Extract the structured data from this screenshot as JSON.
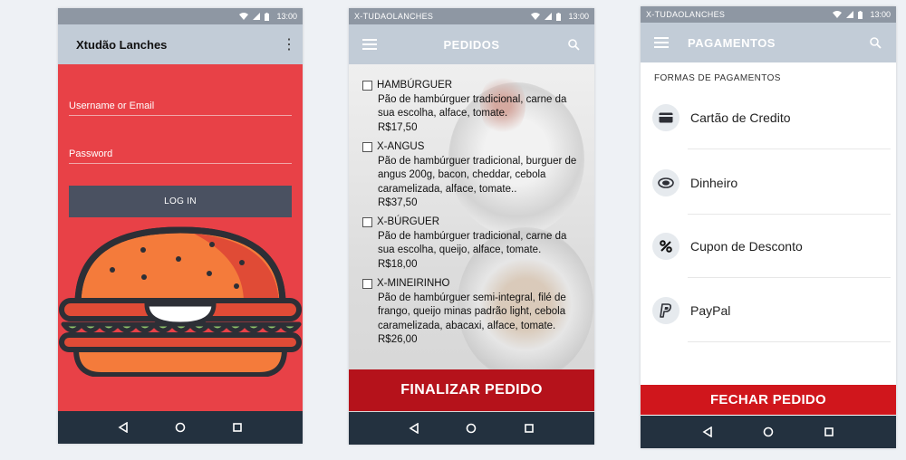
{
  "status": {
    "time": "13:00"
  },
  "screen1": {
    "app_title": "Xtudão Lanches",
    "username_placeholder": "Username or Email",
    "password_placeholder": "Password",
    "login_label": "LOG IN"
  },
  "screen2": {
    "carrier": "X-TUDAOLANCHES",
    "title": "PEDIDOS",
    "items": [
      {
        "name": "HAMBÚRGUER",
        "desc": "Pão de hambúrguer tradicional, carne da sua escolha, alface, tomate.",
        "price": "R$17,50"
      },
      {
        "name": "X-ANGUS",
        "desc": "Pão de hambúrguer tradicional, burguer de angus 200g, bacon, cheddar, cebola caramelizada, alface, tomate..",
        "price": "R$37,50"
      },
      {
        "name": "X-BÚRGUER",
        "desc": "Pão de hambúrguer tradicional, carne da sua escolha, queijo, alface, tomate.",
        "price": "R$18,00"
      },
      {
        "name": "X-MINEIRINHO",
        "desc": "Pão de hambúrguer semi-integral, filé de frango, queijo minas padrão light, cebola caramelizada, abacaxi, alface, tomate.",
        "price": "R$26,00"
      }
    ],
    "finalize_label": "FINALIZAR PEDIDO"
  },
  "screen3": {
    "carrier": "X-TUDAOLANCHES",
    "title": "PAGAMENTOS",
    "section_label": "FORMAS DE PAGAMENTOS",
    "methods": [
      {
        "label": "Cartão de Credito",
        "icon": "credit-card-icon"
      },
      {
        "label": "Dinheiro",
        "icon": "money-icon"
      },
      {
        "label": "Cupon de Desconto",
        "icon": "percent-icon"
      },
      {
        "label": "PayPal",
        "icon": "paypal-icon"
      }
    ],
    "close_label": "FECHAR PEDIDO"
  },
  "colors": {
    "login_bg": "#e84147",
    "appbar": "#c2ccd7",
    "navbar": "#23313f",
    "finalize": "#b5121b",
    "close": "#d0161c",
    "button_dark": "#4a5161"
  }
}
